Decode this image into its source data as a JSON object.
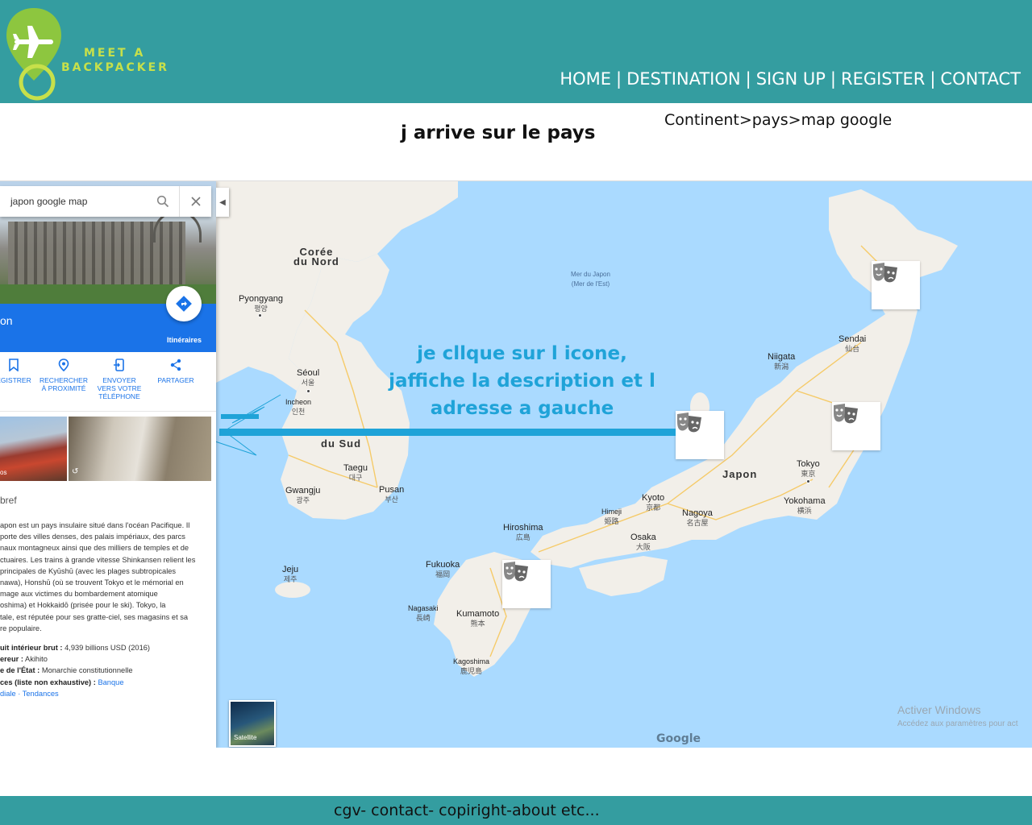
{
  "header": {
    "logo_line1": "MEET A",
    "logo_line2": "BACKPACKER",
    "nav": [
      "HOME",
      "DESTINATION",
      "SIGN UP",
      "REGISTER",
      "CONTACT"
    ],
    "nav_separator": "|",
    "colors": {
      "header_bg": "#349da0",
      "logo_green": "#c7e04a",
      "logo_plane": "#ffffff"
    }
  },
  "page": {
    "title": "j arrive sur le pays",
    "breadcrumb": "Continent>pays>map google"
  },
  "map": {
    "annotation": "je cllque sur l icone, jaffiche la description et l adresse a gauche",
    "markers_icon": "theater-masks-icon",
    "sea_label": "Mer du Japon",
    "sea_label_sub": "(Mer de l'Est)",
    "satellite_label": "Satellite",
    "google_logo": "Google",
    "watermark_line1": "Activer Windows",
    "watermark_line2": "Accédez aux paramètres pour act",
    "labels": {
      "coree_nord_1": "Corée",
      "coree_nord_2": "du Nord",
      "pyongyang": "Pyongyang",
      "pyongyang_sub": "평양",
      "seoul": "Séoul",
      "seoul_sub": "서울",
      "incheon": "Incheon",
      "incheon_sub": "인천",
      "du_sud": "du Sud",
      "taegu": "Taegu",
      "taegu_sub": "대구",
      "gwangju": "Gwangju",
      "gwangju_sub": "광주",
      "pusan": "Pusan",
      "pusan_sub": "부산",
      "jeju": "Jeju",
      "jeju_sub": "제주",
      "japon": "Japon",
      "sendai": "Sendai",
      "sendai_sub": "仙台",
      "niigata": "Niigata",
      "niigata_sub": "新潟",
      "tokyo": "Tokyo",
      "tokyo_sub": "東京",
      "yokohama": "Yokohama",
      "yokohama_sub": "横浜",
      "kyoto": "Kyoto",
      "kyoto_sub": "京都",
      "nagoya": "Nagoya",
      "nagoya_sub": "名古屋",
      "himeji": "Himeji",
      "himeji_sub": "姫路",
      "osaka": "Osaka",
      "osaka_sub": "大阪",
      "hiroshima": "Hiroshima",
      "hiroshima_sub": "広島",
      "fukuoka": "Fukuoka",
      "fukuoka_sub": "福岡",
      "nagasaki": "Nagasaki",
      "nagasaki_sub": "長崎",
      "kumamoto": "Kumamoto",
      "kumamoto_sub": "熊本",
      "kagoshima": "Kagoshima",
      "kagoshima_sub": "鹿児島"
    },
    "colors": {
      "water": "#aadaff",
      "land": "#f2efe9",
      "annotation": "#1fa3d8"
    }
  },
  "panel": {
    "search_query": "japon google map",
    "title": "on",
    "itineraires": "Itinéraires",
    "actions": [
      {
        "label_1": "EGISTRER",
        "label_2": "",
        "label_3": ""
      },
      {
        "label_1": "RECHERCHER",
        "label_2": "À PROXIMITÉ",
        "label_3": ""
      },
      {
        "label_1": "ENVOYER",
        "label_2": "VERS VOTRE",
        "label_3": "TÉLÉPHONE"
      },
      {
        "label_1": "PARTAGER",
        "label_2": "",
        "label_3": ""
      }
    ],
    "photo1_label": "os",
    "section": "bref",
    "description": [
      "apon est un pays insulaire situé dans l'océan Pacifique. Il",
      "porte des villes denses, des palais impériaux, des parcs",
      "naux montagneux ainsi que des milliers de temples et de",
      "ctuaires. Les trains à grande vitesse Shinkansen relient les",
      "principales de Kyūshū (avec les plages subtropicales",
      "nawa), Honshū (où se trouvent Tokyo et le mémorial en",
      "mage aux victimes du bombardement atomique",
      "oshima) et Hokkaidō (prisée pour le ski). Tokyo, la",
      "tale, est réputée pour ses gratte-ciel, ses magasins et sa",
      "re populaire."
    ],
    "facts": {
      "pib_label": "uit intérieur brut :",
      "pib_value": "4,939 billions USD (2016)",
      "emp_label": "ereur :",
      "emp_value": "Akihito",
      "chef_label": "e de l'État :",
      "chef_value": "Monarchie constitutionnelle",
      "src_label": "ces (liste non exhaustive) :",
      "src_value": "Banque",
      "src_line2": "diale · Tendances"
    }
  },
  "footer": {
    "text": "cgv- contact- copiright-about etc..."
  }
}
